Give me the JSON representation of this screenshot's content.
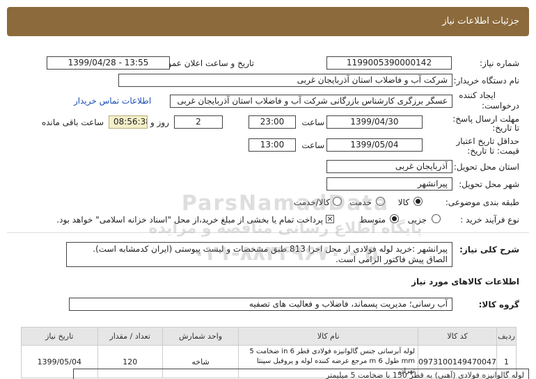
{
  "header": {
    "title": "جزئیات اطلاعات نیاز"
  },
  "form": {
    "need_number_label": "شماره نیاز:",
    "need_number": "1199005390000142",
    "announce_label": "تاریخ و ساعت اعلان عمومی:",
    "announce_value": "1399/04/28 - 13:55",
    "buyer_org_label": "نام دستگاه خریدار:",
    "buyer_org": "شرکت آب و فاضلاب استان آذربایجان غربی",
    "creator_label_1": "ایجاد کننده",
    "creator_label_2": "درخواست:",
    "creator": "عسگر  برزگری کارشناس بازرگانی شرکت آب و فاضلاب استان آذربایجان غربی",
    "contact_link": "اطلاعات تماس خریدار",
    "reply_deadline_label_1": "مهلت ارسال پاسخ:",
    "reply_deadline_label_2": "تا تاریخ:",
    "reply_date": "1399/04/30",
    "time_label": "ساعت",
    "reply_time": "23:00",
    "days_value": "2",
    "days_label": "روز و",
    "remaining_time": "08:56:38",
    "remaining_label": "ساعت باقی مانده",
    "price_validity_label_1": "حداقل تاریخ اعتبار",
    "price_validity_label_2": "قیمت: تا تاریخ:",
    "price_date": "1399/05/04",
    "price_time": "13:00",
    "province_label": "استان محل تحویل:",
    "province": "آذربایجان غربی",
    "city_label": "شهر محل تحویل:",
    "city": "پیرانشهر",
    "category_label": "طبقه بندی موضوعی:",
    "category_options": [
      "کالا",
      "خدمت",
      "کالا/خدمت"
    ],
    "process_label": "نوع فرآیند خرید :",
    "process_options": [
      "جزیی",
      "متوسط"
    ],
    "payment_note": "پرداخت تمام یا بخشی از مبلغ خرید،از محل \"اسناد خزانه اسلامی\" خواهد بود."
  },
  "description": {
    "label": "شرح کلی نیاز:",
    "text": "پیرانشهر :خرید لوله فولادی از محل اجرا 813 طبق مشخصات و لیست پیوستی (ایران کدمشابه است). الصاق پیش فاکتور الزامی است."
  },
  "goods": {
    "section_title": "اطلاعات کالاهای مورد نیاز",
    "group_label": "گروه کالا:",
    "group_value": "آب رسانی؛ مدیریت پسماند، فاضلاب و فعالیت های تصفیه",
    "columns": [
      "ردیف",
      "کد کالا",
      "نام کالا",
      "واحد شمارش",
      "تعداد / مقدار",
      "تاریخ نیاز"
    ],
    "rows": [
      {
        "row": "1",
        "code": "0973100149470047",
        "name": "لوله آبرسانی جنس گالوانیزه فولادی قطر 6 in ضخامت 5 mm طول 6 m مرجع عرضه کننده لوله و پروفیل سپنتا تهران",
        "unit": "شاخه",
        "qty": "120",
        "date": "1399/05/04"
      }
    ]
  },
  "watermark": {
    "line1": "ParsNamadData",
    "line2": "پایگاه اطلاع رسانی مناقصه و مزایده",
    "line3": "۰۲۱-۸۸۳۴۹۶۷۰ - ۵"
  },
  "bottom_note": "لوله گالوانیزه فولادی (آهنی) به قطر 150 با ضخامت 5 میلیمتر"
}
